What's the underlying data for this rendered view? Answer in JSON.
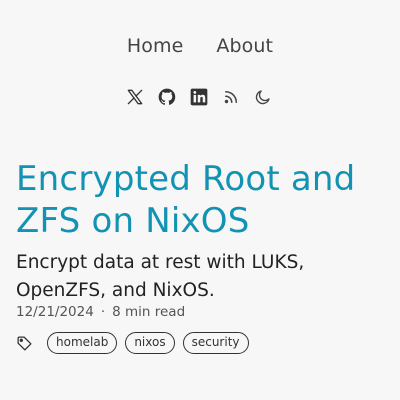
{
  "nav": {
    "items": [
      {
        "label": "Home"
      },
      {
        "label": "About"
      }
    ]
  },
  "social": {
    "icons": [
      "x-icon",
      "github-icon",
      "linkedin-icon",
      "rss-icon",
      "moon-icon"
    ]
  },
  "post": {
    "title": "Encrypted Root and ZFS on NixOS",
    "subtitle": "Encrypt data at rest with LUKS, OpenZFS, and NixOS.",
    "date": "12/21/2024",
    "separator": "·",
    "reading_time": "8 min read",
    "tags": [
      "homelab",
      "nixos",
      "security"
    ]
  },
  "colors": {
    "title": "#1293b4",
    "background": "#f7f7f7"
  }
}
